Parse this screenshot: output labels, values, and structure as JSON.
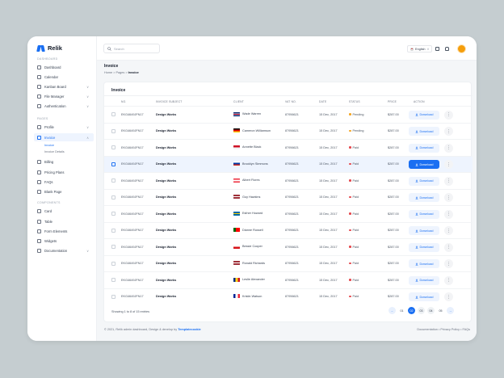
{
  "app": {
    "name": "Relik"
  },
  "sidebar": {
    "sections": [
      "DASHBOARD",
      "PAGES",
      "COMPONENTS"
    ],
    "items": [
      {
        "label": "Dashboard",
        "icon": "grid-icon"
      },
      {
        "label": "Calendar",
        "icon": "calendar-icon"
      },
      {
        "label": "Kanban Board",
        "icon": "kanban-icon",
        "chevron": "∨"
      },
      {
        "label": "File Manager",
        "icon": "folder-icon",
        "chevron": "∨"
      },
      {
        "label": "Authentication",
        "icon": "lock-icon",
        "chevron": "∨"
      },
      {
        "label": "Profile",
        "icon": "user-icon",
        "chevron": "∨"
      },
      {
        "label": "Invoice",
        "icon": "invoice-icon",
        "chevron": "∧",
        "active": true
      },
      {
        "label": "Billing",
        "icon": "card-icon"
      },
      {
        "label": "Pricing Plans",
        "icon": "tag-icon"
      },
      {
        "label": "FAQs",
        "icon": "help-icon"
      },
      {
        "label": "Blank Page",
        "icon": "page-icon"
      },
      {
        "label": "Card",
        "icon": "card-icon"
      },
      {
        "label": "Table",
        "icon": "table-icon"
      },
      {
        "label": "Form Elements",
        "icon": "form-icon"
      },
      {
        "label": "Widgets",
        "icon": "widget-icon"
      },
      {
        "label": "Documentation",
        "icon": "doc-icon",
        "chevron": "∨"
      }
    ],
    "invoice_sub": [
      "Invoice",
      "Invoice Details"
    ]
  },
  "topbar": {
    "search_placeholder": "Search",
    "language": "English",
    "language_chevron": "∨"
  },
  "page": {
    "title": "Invoice",
    "breadcrumb": [
      "Home",
      "Pages",
      "Invoice"
    ],
    "breadcrumb_sep": ">"
  },
  "card": {
    "title": "Invoice"
  },
  "table": {
    "headers": [
      "NO.",
      "INVOICE SUBJECT",
      "CLIENT",
      "VAT NO.",
      "DATE",
      "STATUS",
      "PRICE",
      "ACTION"
    ],
    "download_label": "Download",
    "more_glyph": "⋮",
    "rows": [
      {
        "no": "EKG4649JFN17",
        "subject": "Design Works",
        "client": "Wade Warren",
        "flag": "gb",
        "vat": "87956621",
        "date": "15 Dec, 2017",
        "status": "Pending",
        "price": "$287.00"
      },
      {
        "no": "EKG4649JFN17",
        "subject": "Design Works",
        "client": "Cameron Williamson",
        "flag": "de",
        "vat": "87956621",
        "date": "15 Dec, 2017",
        "status": "Pending",
        "price": "$287.00"
      },
      {
        "no": "EKG4649JFN17",
        "subject": "Design Works",
        "client": "Annette Black",
        "flag": "id",
        "vat": "87956621",
        "date": "15 Dec, 2017",
        "status": "Paid",
        "price": "$287.00"
      },
      {
        "no": "EKG4649JFN17",
        "subject": "Design Works",
        "client": "Brooklyn Simmons",
        "flag": "ru",
        "vat": "87956621",
        "date": "15 Dec, 2017",
        "status": "Paid",
        "price": "$287.00",
        "highlight": true
      },
      {
        "no": "EKG4649JFN17",
        "subject": "Design Works",
        "client": "Albert Flores",
        "flag": "at",
        "vat": "87956621",
        "date": "15 Dec, 2017",
        "status": "Paid",
        "price": "$287.00"
      },
      {
        "no": "EKG4649JFN17",
        "subject": "Design Works",
        "client": "Guy Hawkins",
        "flag": "lv",
        "vat": "87956621",
        "date": "15 Dec, 2017",
        "status": "Paid",
        "price": "$287.00"
      },
      {
        "no": "EKG4649JFN17",
        "subject": "Design Works",
        "client": "Esther Howard",
        "flag": "se",
        "vat": "87956621",
        "date": "15 Dec, 2017",
        "status": "Paid",
        "price": "$287.00"
      },
      {
        "no": "EKG4649JFN17",
        "subject": "Design Works",
        "client": "Dianne Russell",
        "flag": "pt",
        "vat": "87956621",
        "date": "15 Dec, 2017",
        "status": "Paid",
        "price": "$287.00"
      },
      {
        "no": "EKG4649JFN17",
        "subject": "Design Works",
        "client": "Bessie Cooper",
        "flag": "cz",
        "vat": "87956621",
        "date": "15 Dec, 2017",
        "status": "Paid",
        "price": "$287.00"
      },
      {
        "no": "EKG4649JFN17",
        "subject": "Design Works",
        "client": "Ronald Richards",
        "flag": "lv",
        "vat": "87956621",
        "date": "15 Dec, 2017",
        "status": "Paid",
        "price": "$287.00"
      },
      {
        "no": "EKG4649JFN17",
        "subject": "Design Works",
        "client": "Leslie Alexander",
        "flag": "ro",
        "vat": "87956621",
        "date": "15 Dec, 2017",
        "status": "Paid",
        "price": "$287.00"
      },
      {
        "no": "EKG4649JFN17",
        "subject": "Design Works",
        "client": "Kristin Watson",
        "flag": "fr",
        "vat": "87956621",
        "date": "15 Dec, 2017",
        "status": "Paid",
        "price": "$287.00"
      }
    ]
  },
  "pagination": {
    "showing": "Showing 1 to 8 of 15 entries",
    "pages": [
      "01",
      "02",
      "03",
      "04",
      "05"
    ],
    "active_page": "02",
    "prev": "←",
    "next": "→"
  },
  "footer": {
    "copyright": "© 2021, Relik admin dashboard, Design & develop by",
    "author": "Templatecookie",
    "links": [
      "Documentation",
      "Privacy Policy",
      "FAQs"
    ],
    "sep": "•"
  },
  "colors": {
    "accent": "#1a6ff2",
    "pending": "#f5a623",
    "paid": "#e5484d"
  },
  "flags": {
    "gb": "linear-gradient(0deg,#012169 30%,#fff 30%,#fff 40%,#c8102e 40%,#c8102e 60%,#fff 60%,#fff 70%,#012169 70%)",
    "de": "linear-gradient(#000 33%,#dd0000 33%,#dd0000 66%,#ffce00 66%)",
    "id": "linear-gradient(#ce1126 50%,#f3f4f6 50%)",
    "ru": "linear-gradient(#fff 33%,#0039a6 33%,#0039a6 66%,#d52b1e 66%)",
    "at": "linear-gradient(#ed2939 33%,#fff 33%,#fff 66%,#ed2939 66%)",
    "lv": "linear-gradient(#9e3039 40%,#fff 40%,#fff 60%,#9e3039 60%)",
    "se": "linear-gradient(#006aa7 40%,#fecc00 40%,#fecc00 60%,#006aa7 60%)",
    "pt": "linear-gradient(90deg,#006600 40%,#ff0000 40%)",
    "cz": "linear-gradient(#fff 50%,#d7141a 50%)",
    "ro": "linear-gradient(90deg,#002b7f 33%,#fcd116 33%,#fcd116 66%,#ce1126 66%)",
    "fr": "linear-gradient(90deg,#002395 33%,#fff 33%,#fff 66%,#ed2939 66%)"
  }
}
